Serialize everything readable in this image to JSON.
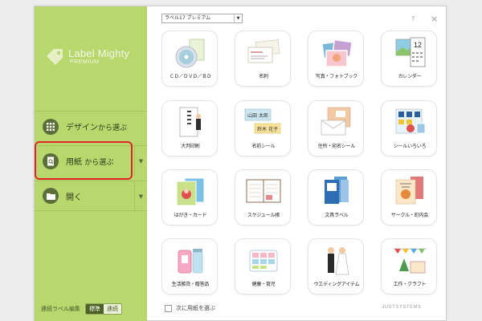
{
  "app": {
    "name": "Label Mighty",
    "edition": "PREMIUM",
    "brand": "JUSTSYSTEMS",
    "help_symbol": "?",
    "close_symbol": "×"
  },
  "sidebar": {
    "design": {
      "label": "デザイン",
      "suffix": "から選ぶ"
    },
    "paper": {
      "label": "用紙",
      "suffix": "から選ぶ"
    },
    "open": {
      "label": "開く"
    },
    "footer": {
      "label": "連続ラベル編集",
      "options": [
        "標準",
        "連続"
      ],
      "selected": "標準"
    }
  },
  "product_select": {
    "value": "ラベル17 プレミアム"
  },
  "categories": [
    {
      "label": "ＣＤ／ＤＶＤ／ＢＤ",
      "icon": "disc-icon"
    },
    {
      "label": "名刺",
      "icon": "business-card-icon"
    },
    {
      "label": "写真・フォトブック",
      "icon": "photo-icon"
    },
    {
      "label": "カレンダー",
      "icon": "calendar-icon"
    },
    {
      "label": "大判印刷",
      "icon": "poster-icon"
    },
    {
      "label": "名前シール",
      "icon": "name-sticker-icon"
    },
    {
      "label": "住所・宛名シール",
      "icon": "address-label-icon"
    },
    {
      "label": "シールいろいろ",
      "icon": "stickers-icon"
    },
    {
      "label": "はがき・カード",
      "icon": "postcard-icon"
    },
    {
      "label": "スケジュール帳",
      "icon": "planner-icon"
    },
    {
      "label": "文具ラベル",
      "icon": "stationery-label-icon"
    },
    {
      "label": "サークル・町内会",
      "icon": "community-icon"
    },
    {
      "label": "生活雑貨・贈答品",
      "icon": "gift-icon"
    },
    {
      "label": "健康・育児",
      "icon": "health-icon"
    },
    {
      "label": "ウエディングアイテム",
      "icon": "wedding-icon"
    },
    {
      "label": "工作・クラフト",
      "icon": "craft-icon"
    }
  ],
  "icon_text": {
    "calendar_number": "12",
    "card_line_1": "山田 太郎",
    "card_line_2": "鈴木 花子"
  },
  "bottom": {
    "checkbox_label": "次に用紙を選ぶ",
    "checked": false
  },
  "colors": {
    "sidebar": "#b8d86e",
    "highlight": "#e0242a",
    "sidebar_dark": "#5c6e3a"
  }
}
